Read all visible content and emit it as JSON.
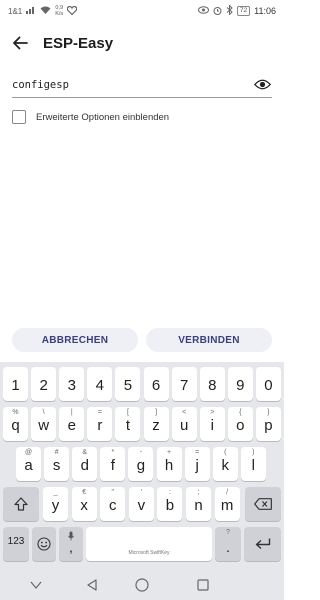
{
  "status_bar": {
    "carrier": "1&1",
    "speed_value": "0,9",
    "speed_unit": "K/s",
    "battery": "72",
    "time": "11:06"
  },
  "app_bar": {
    "title": "ESP-Easy"
  },
  "form": {
    "password_value": "configesp",
    "advanced_options_label": "Erweiterte Optionen einblenden",
    "advanced_options_checked": false
  },
  "actions": {
    "cancel_label": "ABBRECHEN",
    "connect_label": "VERBINDEN"
  },
  "keyboard": {
    "row1": [
      {
        "main": "1"
      },
      {
        "main": "2"
      },
      {
        "main": "3"
      },
      {
        "main": "4"
      },
      {
        "main": "5"
      },
      {
        "main": "6"
      },
      {
        "main": "7"
      },
      {
        "main": "8"
      },
      {
        "main": "9"
      },
      {
        "main": "0"
      }
    ],
    "row2": [
      {
        "hint": "%",
        "main": "q"
      },
      {
        "hint": "\\",
        "main": "w"
      },
      {
        "hint": "|",
        "main": "e"
      },
      {
        "hint": "=",
        "main": "r"
      },
      {
        "hint": "[",
        "main": "t"
      },
      {
        "hint": "]",
        "main": "z"
      },
      {
        "hint": "<",
        "main": "u"
      },
      {
        "hint": ">",
        "main": "i"
      },
      {
        "hint": "{",
        "main": "o"
      },
      {
        "hint": "}",
        "main": "p"
      }
    ],
    "row3": [
      {
        "hint": "@",
        "main": "a"
      },
      {
        "hint": "#",
        "main": "s"
      },
      {
        "hint": "&",
        "main": "d"
      },
      {
        "hint": "*",
        "main": "f"
      },
      {
        "hint": "-",
        "main": "g"
      },
      {
        "hint": "+",
        "main": "h"
      },
      {
        "hint": "=",
        "main": "j"
      },
      {
        "hint": "(",
        "main": "k"
      },
      {
        "hint": ")",
        "main": "l"
      }
    ],
    "row4": [
      {
        "hint": "_",
        "main": "y"
      },
      {
        "hint": "€",
        "main": "x"
      },
      {
        "hint": "\"",
        "main": "c"
      },
      {
        "hint": "'",
        "main": "v"
      },
      {
        "hint": ":",
        "main": "b"
      },
      {
        "hint": ";",
        "main": "n"
      },
      {
        "hint": "/",
        "main": "m"
      }
    ],
    "symbols_label": "123",
    "comma_label": ",",
    "comma_hint": "-",
    "space_label": "Microsoft SwiftKey",
    "period_label": ".",
    "period_hint": "?"
  }
}
